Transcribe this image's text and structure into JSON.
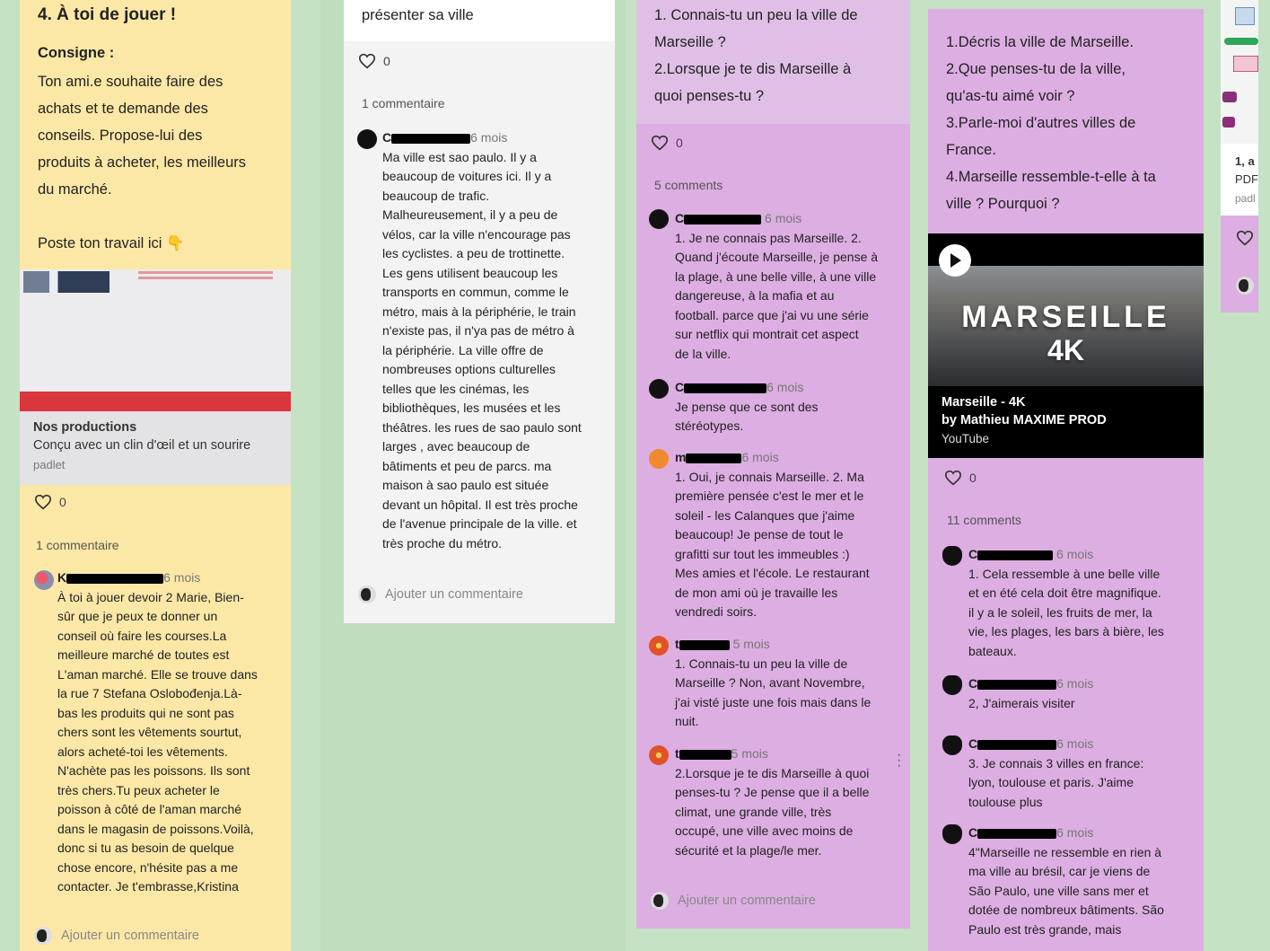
{
  "col1": {
    "title": "4. À toi de jouer !",
    "consigne_label": "Consigne :",
    "consigne_lines": [
      "Ton ami.e souhaite faire des",
      "achats et te demande des",
      "conseils. Propose-lui des",
      "produits à acheter, les meilleurs",
      "du marché."
    ],
    "poste": "Poste ton travail ici 👇",
    "preview_title": "Nos productions",
    "preview_sub": "Conçu avec un clin d'œil et un sourire",
    "preview_site": "padlet",
    "likes": "0",
    "comment_count": "1 commentaire",
    "comment": {
      "name": "K",
      "ago": "6 mois",
      "lines": [
        "À toi à jouer devoir 2 Marie, Bien-",
        "sûr que je peux te donner un",
        "conseil où faire les courses.La",
        "meilleure marché de toutes est",
        "L'aman marché. Elle se trouve dans",
        "la rue 7 Stefana Oslobođenja.Là-",
        "bas les produits qui ne sont pas",
        "chers sont les vêtements sourtut,",
        "alors acheté-toi les vêtements.",
        "N'achète pas les poissons. Ils sont",
        "très chers.Tu peux acheter le",
        "poisson à côté de l'aman marché",
        "dans le magasin de poissons.Voilà,",
        "donc si tu as besoin de quelque",
        "chose encore, n'hésite pas a me",
        "contacter. Je t'embrasse,Kristina"
      ]
    },
    "add_comment": "Ajouter un commentaire"
  },
  "col2": {
    "title": "présenter sa ville",
    "likes": "0",
    "comment_count": "1 commentaire",
    "comment": {
      "name": "C",
      "ago": "6 mois",
      "lines": [
        "Ma ville est sao paulo. Il y a",
        "beaucoup de voitures ici. Il y a",
        "beaucoup de trafic.",
        "Malheureusement, il y a peu de",
        "vélos, car la ville n'encourage pas",
        "les cyclistes. a peu de trottinette.",
        "Les gens utilisent beaucoup les",
        "transports en commun, comme le",
        "métro, mais à la périphérie, le train",
        "n'existe pas, il n'ya pas de métro à",
        "la périphérie. La ville offre de",
        "nombreuses options culturelles",
        "telles que les cinémas, les",
        "bibliothèques, les musées et les",
        "théâtres. les rues de sao paulo sont",
        "larges , avec beaucoup de",
        "bâtiments et peu de parcs. ma",
        "maison à sao paulo est située",
        "devant un hôpital. Il est très proche",
        "de l'avenue principale de la ville. et",
        "très proche du métro."
      ]
    },
    "add_comment": "Ajouter un commentaire"
  },
  "col3": {
    "questions": [
      "1. Connais-tu un peu la ville de",
      "Marseille ?",
      "2.Lorsque je te dis Marseille à",
      "quoi penses-tu ?"
    ],
    "likes": "0",
    "comment_count": "5 comments",
    "comments": [
      {
        "name": "C",
        "ago": "6 mois",
        "avatar": "#111111",
        "lines": [
          "1. Je ne connais pas Marseille. 2.",
          "Quand j'écoute Marseille, je pense à",
          "la plage, à une belle ville, à une ville",
          "dangereuse, à la mafia et au",
          "football. parce que j'ai vu une série",
          "sur netflix qui montrait cet aspect",
          "de la ville."
        ]
      },
      {
        "name": "C",
        "ago": "6 mois",
        "avatar": "#111111",
        "lines": [
          "Je pense que ce sont des",
          "stéréotypes."
        ]
      },
      {
        "name": "m",
        "ago": "6 mois",
        "avatar": "#ef8a2e",
        "lines": [
          "1. Oui, je connais Marseille. 2. Ma",
          "première pensée c'est le mer et le",
          "soleil - les Calanques que j'aime",
          "beaucoup! Je pense de tout le",
          "grafitti sur tout les immeubles :)",
          "Mes amies et l'école. Le restaurant",
          "de mon ami où je travaille les",
          "vendredi soirs."
        ]
      },
      {
        "name": "t",
        "ago": "5 mois",
        "avatar": "#e2522a",
        "lines": [
          "1. Connais-tu un peu la ville de",
          "Marseille ? Non, avant Novembre,",
          "j'ai visté juste une fois mais dans le",
          "nuit."
        ]
      },
      {
        "name": "t",
        "ago": "5 mois",
        "avatar": "#e2522a",
        "lines": [
          "2.Lorsque je te dis Marseille à quoi",
          "penses-tu ? Je pense que il a belle",
          "climat, une grande ville, très",
          "occupé, une ville avec moins de",
          "sécurité et la plage/le mer."
        ]
      }
    ],
    "add_comment": "Ajouter un commentaire"
  },
  "col4": {
    "questions": [
      "1.Décris la ville de Marseille.",
      "2.Que penses-tu de la ville,",
      "qu'as-tu aimé voir ?",
      "3.Parle-moi d'autres villes de",
      "France.",
      "4.Marseille ressemble-t-elle à ta",
      "ville ? Pourquoi ?"
    ],
    "video": {
      "overlay_title": "MARSEILLE",
      "overlay_sub": "4K",
      "title": "Marseille - 4K",
      "author": "by Mathieu MAXIME PROD",
      "source": "YouTube"
    },
    "likes": "0",
    "comment_count": "11 comments",
    "comments": [
      {
        "name": "C",
        "ago": "6 mois",
        "lines": [
          "1. Cela ressemble à une belle ville",
          "et en été cela doit être magnifique.",
          "il y a le soleil, les fruits de mer, la",
          "vie, les plages, les bars à bière, les",
          "bateaux."
        ]
      },
      {
        "name": "C",
        "ago": "6 mois",
        "lines": [
          "2, J'aimerais visiter"
        ]
      },
      {
        "name": "C",
        "ago": "6 mois",
        "lines": [
          "3. Je connais 3 villes en france:",
          "lyon, toulouse et paris. J'aime",
          "toulouse plus"
        ]
      },
      {
        "name": "C",
        "ago": "6 mois",
        "lines": [
          "4\"Marseille ne ressemble en rien à",
          "ma ville au brésil, car je viens de",
          "São Paulo, une ville sans mer et",
          "dotée de nombreux bâtiments. São",
          "Paulo est très grande, mais"
        ]
      }
    ]
  },
  "col5": {
    "label1": "1, a",
    "label2": "PDF",
    "label3": "padl"
  },
  "colors": {
    "background": "#c5e2c4",
    "yellow_card": "#fce8a6",
    "purple_card": "#dcaee2",
    "purple_header": "#dfbfe6",
    "red_bar": "#d9363e"
  }
}
